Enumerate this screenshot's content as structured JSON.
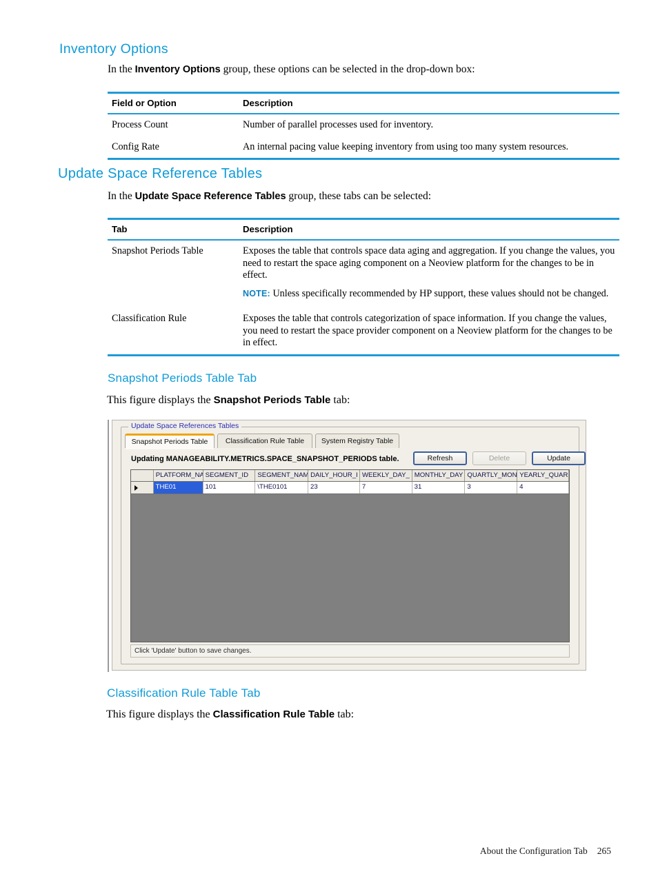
{
  "colors": {
    "heading_blue": "#0f9bd7",
    "rule_blue": "#1f9ad6",
    "note_blue": "#0b7fc0",
    "tab_accent_orange": "#f0a30a",
    "grid_selection_blue": "#2b5fd9",
    "grid_empty_grey": "#808080"
  },
  "sections": {
    "inventory_options": {
      "heading": "Inventory Options",
      "intro_pre": "In the ",
      "intro_bold": "Inventory Options",
      "intro_post": " group, these options can be selected in the drop-down box:",
      "table": {
        "headers": [
          "Field or Option",
          "Description"
        ],
        "rows": [
          {
            "field": "Process Count",
            "description": "Number of parallel processes used for inventory."
          },
          {
            "field": "Config Rate",
            "description": "An internal pacing value keeping inventory from using too many system resources."
          }
        ]
      }
    },
    "update_space_reference_tables": {
      "heading": "Update Space Reference Tables",
      "intro_pre": "In the ",
      "intro_bold": "Update Space Reference Tables",
      "intro_post": " group, these tabs can be selected:",
      "table": {
        "headers": [
          "Tab",
          "Description"
        ],
        "rows": [
          {
            "tab": "Snapshot Periods Table",
            "description": "Exposes the table that controls space data aging and aggregation. If you change the values, you need to restart the space aging component on a Neoview platform for the changes to be in effect.",
            "note_label": "NOTE:",
            "note_text": "Unless specifically recommended by HP support, these values should not be changed."
          },
          {
            "tab": "Classification Rule",
            "description": "Exposes the table that controls categorization of space information. If you change the values, you need to restart the space provider component on a Neoview platform for the changes to be in effect."
          }
        ]
      }
    },
    "snapshot_periods_table_tab": {
      "heading": "Snapshot Periods Table Tab",
      "caption_pre": "This figure displays the ",
      "caption_bold": "Snapshot Periods Table",
      "caption_post": " tab:"
    },
    "classification_rule_table_tab": {
      "heading": "Classification Rule Table Tab",
      "caption_pre": "This figure displays the ",
      "caption_bold": "Classification Rule Table",
      "caption_post": " tab:"
    }
  },
  "figure": {
    "groupbox_label": "Update Space References Tables",
    "tabs": [
      {
        "label": "Snapshot Periods Table",
        "active": true
      },
      {
        "label": "Classification Rule Table",
        "active": false
      },
      {
        "label": "System Registry Table",
        "active": false
      }
    ],
    "update_label": "Updating MANAGEABILITY.METRICS.SPACE_SNAPSHOT_PERIODS table.",
    "buttons": [
      {
        "label": "Refresh",
        "state": "default"
      },
      {
        "label": "Delete",
        "state": "disabled"
      },
      {
        "label": "Update",
        "state": "default"
      }
    ],
    "grid": {
      "columns": [
        "PLATFORM_NA",
        "SEGMENT_ID",
        "SEGMENT_NAM",
        "DAILY_HOUR_I",
        "WEEKLY_DAY_",
        "MONTHLY_DAY",
        "QUARTLY_MON",
        "YEARLY_QUAR"
      ],
      "rows": [
        {
          "selector": "▶",
          "cells": [
            "THE01",
            "101",
            "\\THE0101",
            "23",
            "7",
            "31",
            "3",
            "4"
          ],
          "selected_cell_index": 0
        }
      ]
    },
    "statusbar": "Click 'Update' button to save changes."
  },
  "footer": {
    "text": "About the Configuration Tab",
    "page_number": "265"
  }
}
